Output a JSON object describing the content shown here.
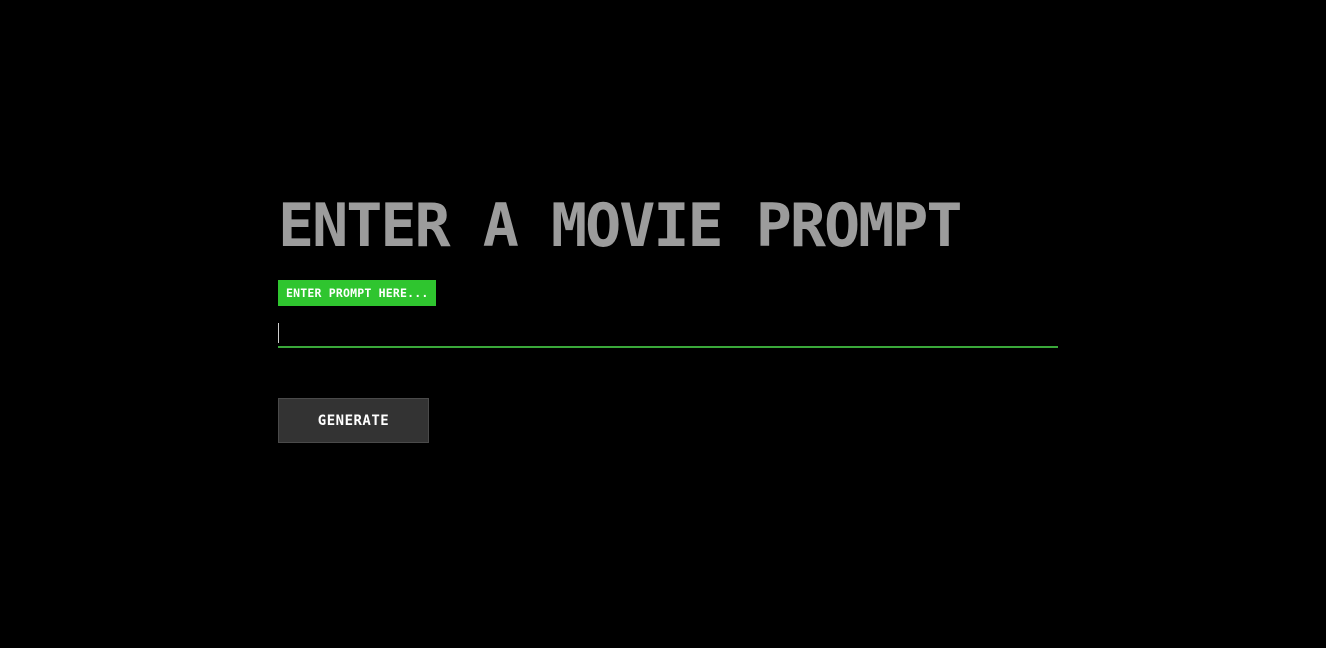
{
  "heading": {
    "text": "ENTER A MOVIE PROMPT"
  },
  "prompt_field": {
    "label": "ENTER PROMPT HERE...",
    "value": "",
    "placeholder": ""
  },
  "actions": {
    "generate_label": "GENERATE"
  },
  "colors": {
    "background": "#000000",
    "heading": "#9c9c9c",
    "label_badge": "#2fc52f",
    "input_underline": "#3aa83a",
    "button_bg": "#333333",
    "button_text": "#ffffff"
  }
}
